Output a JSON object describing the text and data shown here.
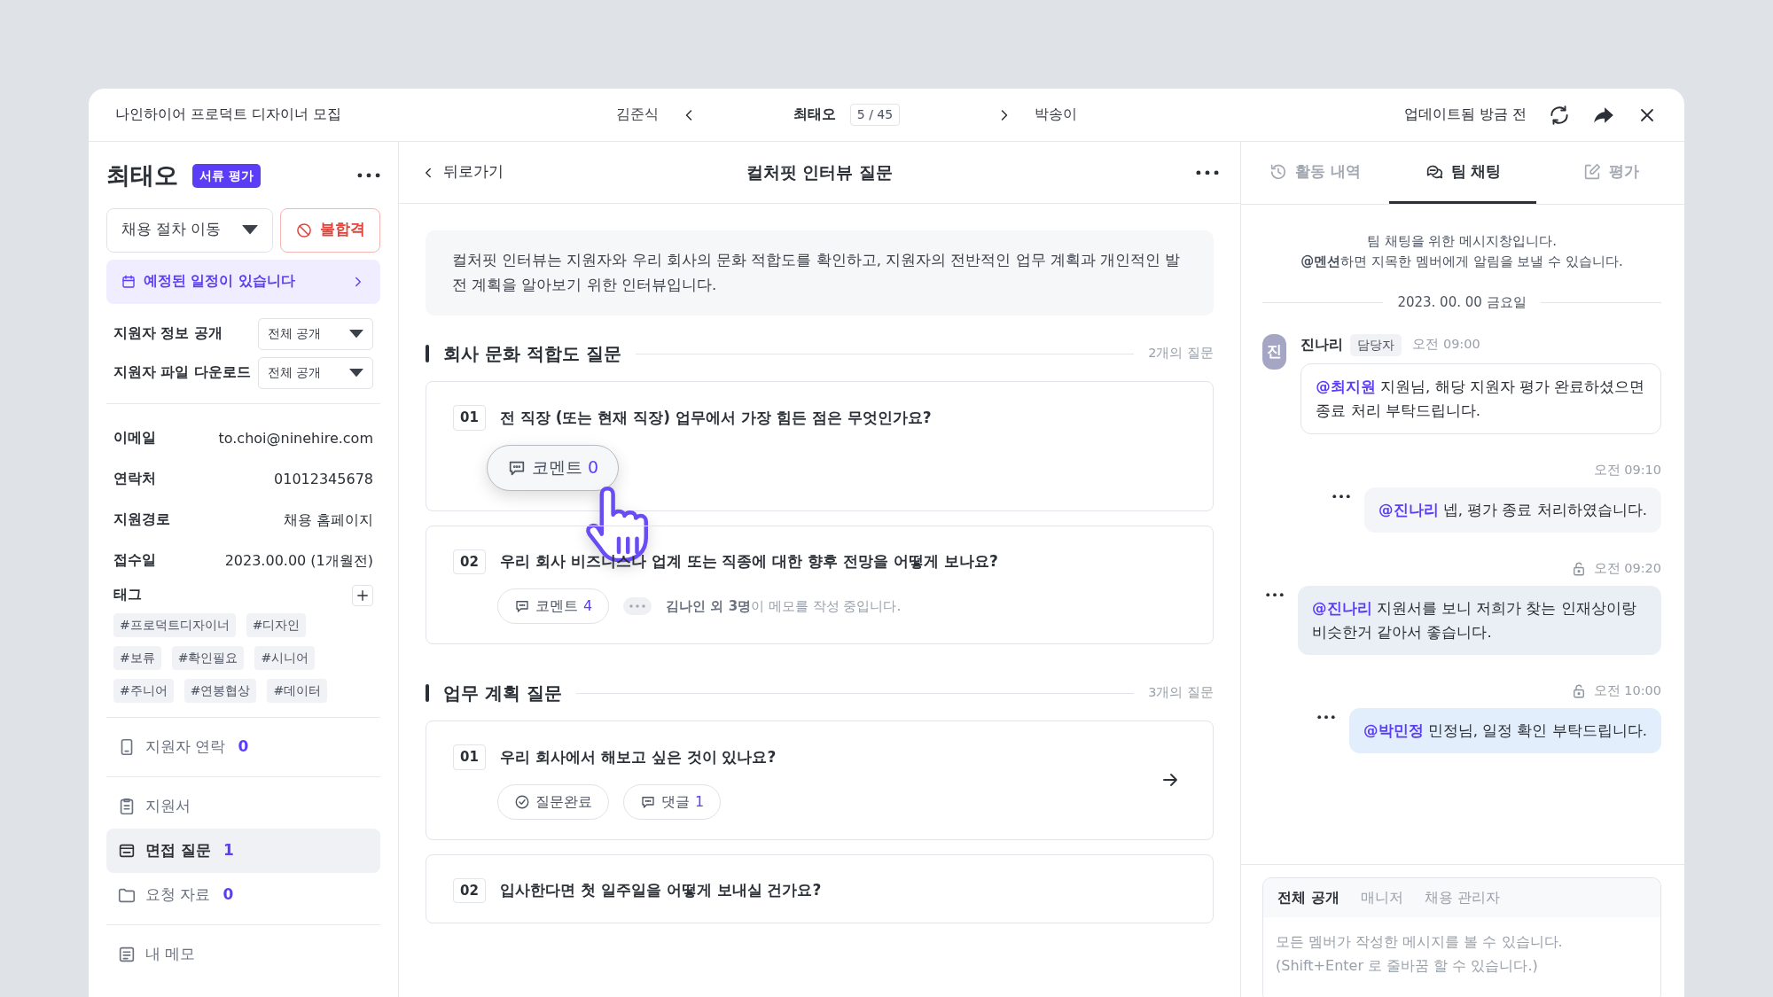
{
  "header": {
    "job_title": "나인하이어 프로덕트 디자이너 모집",
    "prev_name": "김준식",
    "current_name": "최태오",
    "counter": "5 / 45",
    "next_name": "박송이",
    "updated": "업데이트됨 방금 전"
  },
  "candidate": {
    "name": "최태오",
    "stage_badge": "서류 평가",
    "stage_select": "채용 절차 이동",
    "reject_button": "불합격",
    "schedule_banner": "예정된 일정이 있습니다",
    "settings": [
      {
        "label": "지원자 정보 공개",
        "value": "전체 공개"
      },
      {
        "label": "지원자 파일 다운로드",
        "value": "전체 공개"
      }
    ],
    "info": [
      {
        "label": "이메일",
        "value": "to.choi@ninehire.com"
      },
      {
        "label": "연락처",
        "value": "01012345678"
      },
      {
        "label": "지원경로",
        "value": "채용 홈페이지"
      },
      {
        "label": "접수일",
        "value": "2023.00.00 (1개월전)"
      }
    ],
    "tags_label": "태그",
    "tags": [
      "#프로덕트디자이너",
      "#디자인",
      "#보류",
      "#확인필요",
      "#시니어",
      "#주니어",
      "#연봉협상",
      "#데이터"
    ],
    "nav_groups": [
      [
        {
          "kind": "phone",
          "label": "지원자 연락",
          "count": "0",
          "selected": false
        }
      ],
      [
        {
          "kind": "clipboard",
          "label": "지원서",
          "selected": false
        },
        {
          "kind": "card",
          "label": "면접 질문",
          "count": "1",
          "selected": true
        },
        {
          "kind": "folder",
          "label": "요청 자료",
          "count": "0",
          "selected": false
        }
      ],
      [
        {
          "kind": "memo",
          "label": "내 메모",
          "selected": false
        }
      ]
    ]
  },
  "questions_panel": {
    "back": "뒤로가기",
    "title": "컬처핏 인터뷰 질문",
    "intro": "컬처핏 인터뷰는 지원자와 우리 회사의 문화 적합도를 확인하고, 지원자의 전반적인 업무 계획과 개인적인 발전 계획을 알아보기 위한 인터뷰입니다.",
    "sections": [
      {
        "title": "회사 문화 적합도 질문",
        "count": "2개의 질문",
        "questions": [
          {
            "number": "01",
            "text": "전 직장 (또는 현재 직장) 업무에서 가장 힘든 점은 무엇인가요?",
            "arrow": false,
            "actions": [
              {
                "kind": "comment",
                "label": "코멘트",
                "count": "0",
                "hovered": true
              }
            ]
          },
          {
            "number": "02",
            "text": "우리 회사 비즈니스나 업계 또는 직종에 대한 향후 전망을 어떻게 보나요?",
            "arrow": false,
            "actions": [
              {
                "kind": "comment",
                "label": "코멘트",
                "count": "4",
                "hovered": false
              }
            ],
            "typing": "**김나인 외 3명**이 메모를 작성 중입니다."
          }
        ]
      },
      {
        "title": "업무 계획 질문",
        "count": "3개의 질문",
        "questions": [
          {
            "number": "01",
            "text": "우리 회사에서 해보고 싶은 것이 있나요?",
            "arrow": true,
            "actions": [
              {
                "kind": "check",
                "label": "질문완료",
                "hovered": false
              },
              {
                "kind": "comment",
                "label": "댓글",
                "count": "1",
                "hovered": false
              }
            ]
          },
          {
            "number": "02",
            "text": "입사한다면 첫 일주일을 어떻게 보내실 건가요?",
            "arrow": false
          }
        ]
      }
    ]
  },
  "side_panel": {
    "tabs": [
      {
        "kind": "history",
        "label": "활동 내역",
        "selected": false
      },
      {
        "kind": "chat",
        "label": "팀 채팅",
        "selected": true
      },
      {
        "kind": "edit",
        "label": "평가",
        "selected": false
      }
    ],
    "intro": [
      "팀 채팅을 위한 메시지창입니다.",
      "**@멘션**하면 지목한 멤버에게 알림을 보낼 수 있습니다."
    ],
    "date": "2023. 00. 00 금요일",
    "messages": [
      {
        "kind": "received",
        "avatar": "진",
        "author": "진나리",
        "role": "담당자",
        "time": "오전 09:00",
        "mention": "@최지원",
        "text": "지원님, 해당 지원자 평가 완료하셨으면 종료 처리 부탁드립니다."
      },
      {
        "kind": "sent",
        "time": "오전 09:10",
        "private": false,
        "color": "#f4f5f8",
        "mention": "@진나리",
        "text": "넵, 평가 종료 처리하였습니다."
      },
      {
        "kind": "sent",
        "time": "오전 09:20",
        "private": true,
        "color": "#e9eff5",
        "mention": "@진나리",
        "text": "지원서를 보니 저희가 찾는 인재상이랑 비슷한거 같아서 좋습니다."
      },
      {
        "kind": "sent",
        "time": "오전 10:00",
        "private": true,
        "color": "#e3eefc",
        "mention": "@박민정",
        "text": "민정님, 일정 확인 부탁드립니다."
      }
    ],
    "composer": {
      "tabs": [
        {
          "label": "전체 공개",
          "selected": true
        },
        {
          "label": "매니저",
          "selected": false
        },
        {
          "label": "채용 관리자",
          "selected": false
        }
      ],
      "placeholder": "모든 멤버가 작성한 메시지를 볼 수 있습니다.\n(Shift+Enter 로 줄바꿈 할 수 있습니다.)"
    }
  }
}
